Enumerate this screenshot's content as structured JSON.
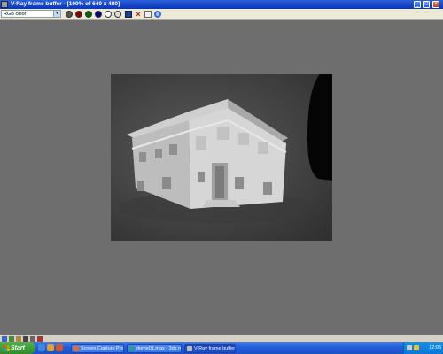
{
  "window": {
    "title": "V-Ray frame buffer - [100% of 640 x 480]",
    "minimize_glyph": "_",
    "maximize_glyph": "□",
    "close_glyph": "×"
  },
  "toolbar": {
    "channel_select": {
      "value": "RGB color"
    },
    "buttons": [
      "channel-toggle",
      "red-channel",
      "green-channel",
      "blue-channel",
      "alpha-channel",
      "mono-channel",
      "save-image",
      "clear-image",
      "track-mouse",
      "display-corrections"
    ]
  },
  "taskbar": {
    "start_label": "Start",
    "tasks": [
      {
        "label": "Screen Capture Profe...",
        "active": false
      },
      {
        "label": "dome01.max - 3ds m...",
        "active": false
      },
      {
        "label": "V-Ray frame buffer - ...",
        "active": true
      }
    ],
    "clock": "12:06"
  },
  "colors": {
    "titlebar": "#0a36b8",
    "taskbar": "#245edb",
    "start": "#2f8a2c",
    "viewport_bg": "#6e6e6e"
  }
}
